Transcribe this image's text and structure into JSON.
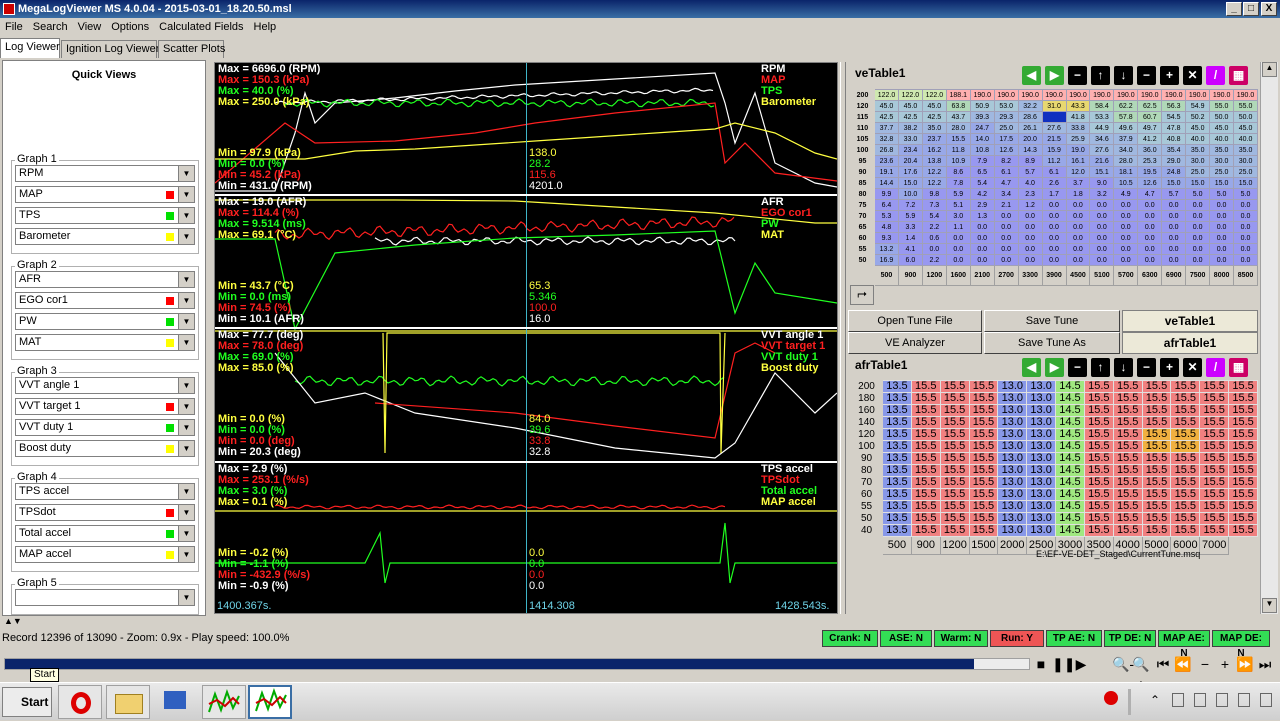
{
  "window": {
    "title": "MegaLogViewer MS 4.0.04 - 2015-03-01_18.20.50.msl",
    "btn_min": "_",
    "btn_max": "□",
    "btn_close": "X"
  },
  "menu": [
    "File",
    "Search",
    "View",
    "Options",
    "Calculated Fields",
    "Help"
  ],
  "tabs": [
    "Log Viewer",
    "Ignition Log Viewer",
    "Scatter Plots"
  ],
  "quick_views": {
    "title": "Quick Views",
    "graphs": [
      {
        "label": "Graph 1",
        "fields": [
          {
            "name": "RPM",
            "color": ""
          },
          {
            "name": "MAP",
            "color": "#ff0000"
          },
          {
            "name": "TPS",
            "color": "#00e000"
          },
          {
            "name": "Barometer",
            "color": "#ffff00"
          }
        ]
      },
      {
        "label": "Graph 2",
        "fields": [
          {
            "name": "AFR",
            "color": ""
          },
          {
            "name": "EGO cor1",
            "color": "#ff0000"
          },
          {
            "name": "PW",
            "color": "#00e000"
          },
          {
            "name": "MAT",
            "color": "#ffff00"
          }
        ]
      },
      {
        "label": "Graph 3",
        "fields": [
          {
            "name": "VVT angle 1",
            "color": ""
          },
          {
            "name": "VVT target 1",
            "color": "#ff0000"
          },
          {
            "name": "VVT duty 1",
            "color": "#00e000"
          },
          {
            "name": "Boost duty",
            "color": "#ffff00"
          }
        ]
      },
      {
        "label": "Graph 4",
        "fields": [
          {
            "name": "TPS accel",
            "color": ""
          },
          {
            "name": "TPSdot",
            "color": "#ff0000"
          },
          {
            "name": "Total accel",
            "color": "#00e000"
          },
          {
            "name": "MAP accel",
            "color": "#ffff00"
          }
        ]
      },
      {
        "label": "Graph 5",
        "fields": [
          {
            "name": "",
            "color": ""
          }
        ]
      }
    ]
  },
  "plot": {
    "graphs": [
      {
        "max": [
          {
            "t": "Max = 6696.0 (RPM)",
            "c": "#ffffff"
          },
          {
            "t": "Max = 150.3 (kPa)",
            "c": "#ff2020"
          },
          {
            "t": "Max = 40.0 (%)",
            "c": "#20ff20"
          },
          {
            "t": "Max = 250.0 (kPa)",
            "c": "#ffff40"
          }
        ],
        "min": [
          {
            "t": "Min = 97.9 (kPa)",
            "c": "#ffff40"
          },
          {
            "t": "Min = 0.0 (%)",
            "c": "#20ff20"
          },
          {
            "t": "Min = 45.2 (kPa)",
            "c": "#ff2020"
          },
          {
            "t": "Min = 431.0 (RPM)",
            "c": "#ffffff"
          }
        ],
        "names": [
          {
            "t": "RPM",
            "c": "#ffffff"
          },
          {
            "t": "MAP",
            "c": "#ff2020"
          },
          {
            "t": "TPS",
            "c": "#20ff20"
          },
          {
            "t": "Barometer",
            "c": "#ffff40"
          }
        ],
        "cur": [
          {
            "t": "138.0",
            "c": "#ffff40"
          },
          {
            "t": "28.2",
            "c": "#20ff20"
          },
          {
            "t": "115.6",
            "c": "#ff2020"
          },
          {
            "t": "4201.0",
            "c": "#ffffff"
          }
        ]
      },
      {
        "max": [
          {
            "t": "Max = 19.0 (AFR)",
            "c": "#ffffff"
          },
          {
            "t": "Max = 114.4 (%)",
            "c": "#ff2020"
          },
          {
            "t": "Max = 9.514 (ms)",
            "c": "#20ff20"
          },
          {
            "t": "Max = 69.1 (°C)",
            "c": "#ffff40"
          }
        ],
        "min": [
          {
            "t": "Min = 43.7 (°C)",
            "c": "#ffff40"
          },
          {
            "t": "Min = 0.0 (ms)",
            "c": "#20ff20"
          },
          {
            "t": "Min = 74.5 (%)",
            "c": "#ff2020"
          },
          {
            "t": "Min = 10.1 (AFR)",
            "c": "#ffffff"
          }
        ],
        "names": [
          {
            "t": "AFR",
            "c": "#ffffff"
          },
          {
            "t": "EGO cor1",
            "c": "#ff2020"
          },
          {
            "t": "PW",
            "c": "#20ff20"
          },
          {
            "t": "MAT",
            "c": "#ffff40"
          }
        ],
        "cur": [
          {
            "t": "65.3",
            "c": "#ffff40"
          },
          {
            "t": "5.346",
            "c": "#20ff20"
          },
          {
            "t": "100.0",
            "c": "#ff2020"
          },
          {
            "t": "16.0",
            "c": "#ffffff"
          }
        ]
      },
      {
        "max": [
          {
            "t": "Max = 77.7 (deg)",
            "c": "#ffffff"
          },
          {
            "t": "Max = 78.0 (deg)",
            "c": "#ff2020"
          },
          {
            "t": "Max = 69.0 (%)",
            "c": "#20ff20"
          },
          {
            "t": "Max = 85.0 (%)",
            "c": "#ffff40"
          }
        ],
        "min": [
          {
            "t": "Min = 0.0 (%)",
            "c": "#ffff40"
          },
          {
            "t": "Min = 0.0 (%)",
            "c": "#20ff20"
          },
          {
            "t": "Min = 0.0 (deg)",
            "c": "#ff2020"
          },
          {
            "t": "Min = 20.3 (deg)",
            "c": "#ffffff"
          }
        ],
        "names": [
          {
            "t": "VVT angle 1",
            "c": "#ffffff"
          },
          {
            "t": "VVT target 1",
            "c": "#ff2020"
          },
          {
            "t": "VVT duty 1",
            "c": "#20ff20"
          },
          {
            "t": "Boost duty",
            "c": "#ffff40"
          }
        ],
        "cur": [
          {
            "t": "84.0",
            "c": "#ffff40"
          },
          {
            "t": "39.6",
            "c": "#20ff20"
          },
          {
            "t": "33.8",
            "c": "#ff2020"
          },
          {
            "t": "32.8",
            "c": "#ffffff"
          }
        ]
      },
      {
        "max": [
          {
            "t": "Max = 2.9 (%)",
            "c": "#ffffff"
          },
          {
            "t": "Max = 253.1 (%/s)",
            "c": "#ff2020"
          },
          {
            "t": "Max = 3.0 (%)",
            "c": "#20ff20"
          },
          {
            "t": "Max = 0.1 (%)",
            "c": "#ffff40"
          }
        ],
        "min": [
          {
            "t": "Min = -0.2 (%)",
            "c": "#ffff40"
          },
          {
            "t": "Min = -1.1 (%)",
            "c": "#20ff20"
          },
          {
            "t": "Min = -432.9 (%/s)",
            "c": "#ff2020"
          },
          {
            "t": "Min = -0.9 (%)",
            "c": "#ffffff"
          }
        ],
        "names": [
          {
            "t": "TPS accel",
            "c": "#ffffff"
          },
          {
            "t": "TPSdot",
            "c": "#ff2020"
          },
          {
            "t": "Total accel",
            "c": "#20ff20"
          },
          {
            "t": "MAP accel",
            "c": "#ffff40"
          }
        ],
        "cur": [
          {
            "t": "0.0",
            "c": "#ffff40"
          },
          {
            "t": "0.0",
            "c": "#20ff20"
          },
          {
            "t": "0.0",
            "c": "#ff2020"
          },
          {
            "t": "0.0",
            "c": "#ffffff"
          }
        ]
      }
    ],
    "time_left": "1400.367s.",
    "time_cursor": "1414.308",
    "time_right": "1428.543s."
  },
  "ve_table": {
    "title": "veTable1",
    "rows": [
      200,
      120,
      115,
      110,
      105,
      100,
      95,
      90,
      85,
      80,
      75,
      70,
      65,
      60,
      55,
      50
    ],
    "cols": [
      500,
      900,
      1200,
      1600,
      2100,
      2700,
      3300,
      3900,
      4500,
      5100,
      5700,
      6300,
      6900,
      7500,
      8000,
      8500
    ],
    "values": [
      [
        122.0,
        122.0,
        122.0,
        188.1,
        190.0,
        190.0,
        190.0,
        190.0,
        190.0,
        190.0,
        190.0,
        190.0,
        190.0,
        190.0,
        190.0,
        190.0
      ],
      [
        45.0,
        45.0,
        45.0,
        63.8,
        50.9,
        53.0,
        32.2,
        31.0,
        43.3,
        58.4,
        62.2,
        62.5,
        56.3,
        54.9,
        55.0,
        55.0
      ],
      [
        42.5,
        42.5,
        42.5,
        43.7,
        39.3,
        29.3,
        28.6,
        40.0,
        41.8,
        53.3,
        57.8,
        60.7,
        54.5,
        50.2,
        50.0,
        50.0
      ],
      [
        37.7,
        38.2,
        35.0,
        28.0,
        24.7,
        25.0,
        26.1,
        27.6,
        33.8,
        44.9,
        49.6,
        49.7,
        47.8,
        45.0,
        45.0,
        45.0
      ],
      [
        32.8,
        33.0,
        23.7,
        15.5,
        14.0,
        17.5,
        20.0,
        21.5,
        25.9,
        34.6,
        37.9,
        41.2,
        40.8,
        40.0,
        40.0,
        40.0
      ],
      [
        26.8,
        23.4,
        16.2,
        11.8,
        10.8,
        12.6,
        14.3,
        15.9,
        19.0,
        27.6,
        34.0,
        36.0,
        35.4,
        35.0,
        35.0,
        35.0
      ],
      [
        23.6,
        20.4,
        13.8,
        10.9,
        7.9,
        8.2,
        8.9,
        11.2,
        16.1,
        21.6,
        28.0,
        25.3,
        29.0,
        30.0,
        30.0,
        30.0
      ],
      [
        19.1,
        17.6,
        12.2,
        8.6,
        6.5,
        6.1,
        5.7,
        6.1,
        12.0,
        15.1,
        18.1,
        19.5,
        24.8,
        25.0,
        25.0,
        25.0
      ],
      [
        14.4,
        15.0,
        12.2,
        7.8,
        5.4,
        4.7,
        4.0,
        2.6,
        3.7,
        9.0,
        10.5,
        12.6,
        15.0,
        15.0,
        15.0,
        15.0
      ],
      [
        9.9,
        10.0,
        9.8,
        5.9,
        4.2,
        3.4,
        2.3,
        1.7,
        1.8,
        3.2,
        4.9,
        4.7,
        5.7,
        5.0,
        5.0,
        5.0
      ],
      [
        6.4,
        7.2,
        7.3,
        5.1,
        2.9,
        2.1,
        1.2,
        0.0,
        0.0,
        0.0,
        0.0,
        0.0,
        0.0,
        0.0,
        0.0,
        0.0
      ],
      [
        5.3,
        5.9,
        5.4,
        3.0,
        1.3,
        0.0,
        0.0,
        0.0,
        0.0,
        0.0,
        0.0,
        0.0,
        0.0,
        0.0,
        0.0,
        0.0
      ],
      [
        4.8,
        3.3,
        2.2,
        1.1,
        0.0,
        0.0,
        0.0,
        0.0,
        0.0,
        0.0,
        0.0,
        0.0,
        0.0,
        0.0,
        0.0,
        0.0
      ],
      [
        9.3,
        1.4,
        0.6,
        0.0,
        0.0,
        0.0,
        0.0,
        0.0,
        0.0,
        0.0,
        0.0,
        0.0,
        0.0,
        0.0,
        0.0,
        0.0
      ],
      [
        13.2,
        4.1,
        0.0,
        0.0,
        0.0,
        0.0,
        0.0,
        0.0,
        0.0,
        0.0,
        0.0,
        0.0,
        0.0,
        0.0,
        0.0,
        0.0
      ],
      [
        16.9,
        6.0,
        2.2,
        0.0,
        0.0,
        0.0,
        0.0,
        0.0,
        0.0,
        0.0,
        0.0,
        0.0,
        0.0,
        0.0,
        0.0,
        0.0
      ]
    ]
  },
  "buttons": {
    "open_tune": "Open Tune File",
    "save_tune": "Save Tune",
    "ve_analyzer": "VE Analyzer",
    "save_tune_as": "Save Tune As",
    "active_table_1": "veTable1",
    "active_table_2": "afrTable1"
  },
  "afr_table": {
    "title": "afrTable1",
    "rows": [
      200,
      180,
      160,
      140,
      120,
      100,
      90,
      80,
      70,
      60,
      55,
      50,
      40
    ],
    "cols": [
      500,
      900,
      1200,
      1500,
      2000,
      2500,
      3000,
      3500,
      4000,
      5000,
      6000,
      7000
    ],
    "row_values": [
      "13.5",
      "15.5",
      "15.5",
      "15.5",
      "13.0",
      "13.0",
      "14.5",
      "15.5",
      "15.5",
      "15.5",
      "15.5",
      "15.5",
      "15.5"
    ]
  },
  "tune_path": "E:\\EF-VE-DET_Staged\\CurrentTune.msq",
  "status": {
    "record_text": "Record 12396 of 13090 - Zoom: 0.9x - Play speed: 100.0%",
    "indicators": [
      {
        "t": "Crank: N",
        "c": "#33dd55"
      },
      {
        "t": "ASE: N",
        "c": "#33dd55"
      },
      {
        "t": "Warm: N",
        "c": "#33dd55"
      },
      {
        "t": "Run: Y",
        "c": "#ee5555"
      },
      {
        "t": "TP AE: N",
        "c": "#33dd55"
      },
      {
        "t": "TP DE: N",
        "c": "#33dd55"
      },
      {
        "t": "MAP AE: N",
        "c": "#33dd55"
      },
      {
        "t": "MAP DE: N",
        "c": "#33dd55"
      }
    ],
    "progress": 0.946
  },
  "playback": [
    "■",
    "❚❚",
    "▶",
    "🔍-",
    "🔍+",
    "⏮",
    "⏪",
    "−",
    "+",
    "⏩",
    "⏭"
  ],
  "taskbar": {
    "start": "Start",
    "tooltip": "Start"
  }
}
